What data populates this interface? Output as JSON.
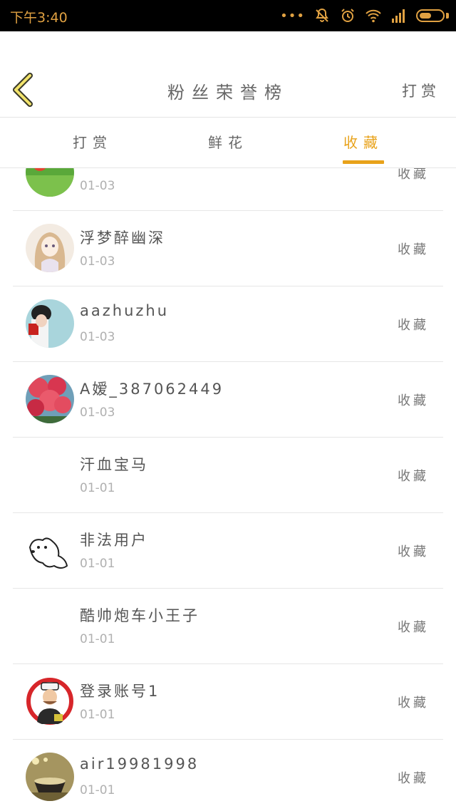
{
  "status_bar": {
    "time": "下午3:40",
    "dots": "•••"
  },
  "header": {
    "title": "粉丝荣誉榜",
    "action_label": "打赏"
  },
  "tabs": [
    {
      "label": "打赏",
      "active": false
    },
    {
      "label": "鲜花",
      "active": false
    },
    {
      "label": "收藏",
      "active": true
    }
  ],
  "list": [
    {
      "name": "",
      "date": "01-03",
      "action": "收藏",
      "avatar": "green-flower-photo"
    },
    {
      "name": "浮梦醉幽深",
      "date": "01-03",
      "action": "收藏",
      "avatar": "anime-girl"
    },
    {
      "name": "aazhuzhu",
      "date": "01-03",
      "action": "收藏",
      "avatar": "girl-photo"
    },
    {
      "name": "A嫒_387062449",
      "date": "01-03",
      "action": "收藏",
      "avatar": "pink-flowers"
    },
    {
      "name": "汗血宝马",
      "date": "01-01",
      "action": "收藏",
      "avatar": "none"
    },
    {
      "name": "非法用户",
      "date": "01-01",
      "action": "收藏",
      "avatar": "dog-sketch"
    },
    {
      "name": "酷帅炮车小王子",
      "date": "01-01",
      "action": "收藏",
      "avatar": "none"
    },
    {
      "name": "登录账号1",
      "date": "01-01",
      "action": "收藏",
      "avatar": "sailor-cartoon"
    },
    {
      "name": "air19981998",
      "date": "01-01",
      "action": "收藏",
      "avatar": "tea-cup"
    }
  ],
  "colors": {
    "accent": "#e8a21a",
    "status_icon": "#e0a142"
  }
}
